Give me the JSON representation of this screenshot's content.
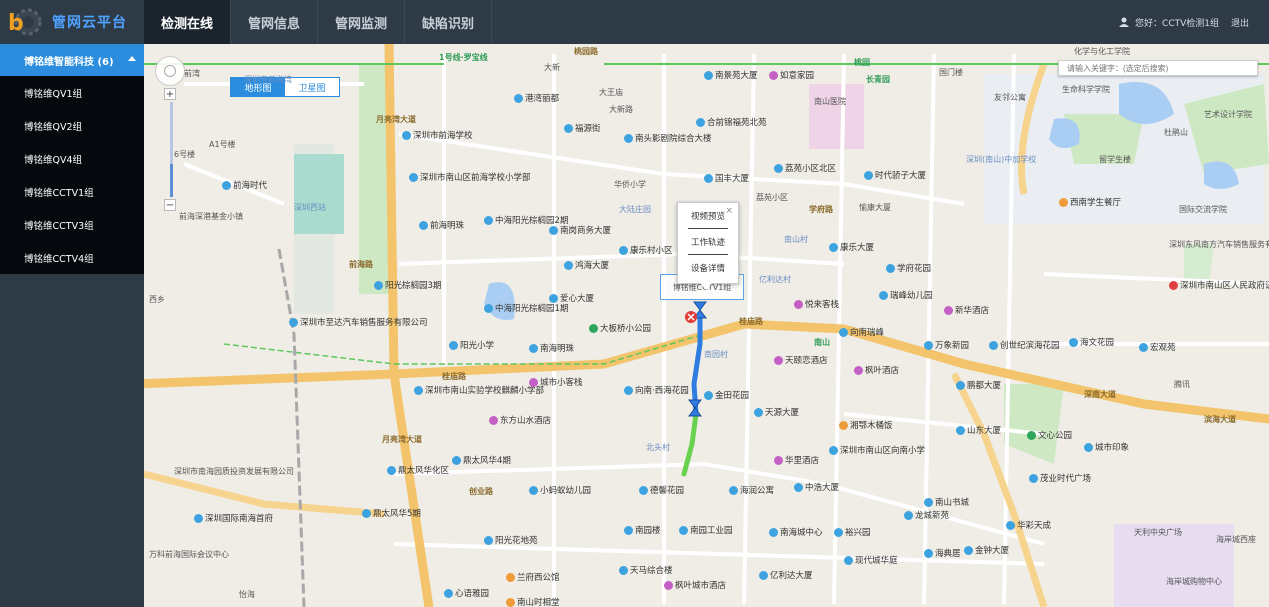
{
  "header": {
    "brand_title": "管网云平台",
    "tabs": [
      {
        "label": "检测在线",
        "active": true
      },
      {
        "label": "管网信息",
        "active": false
      },
      {
        "label": "管网监测",
        "active": false
      },
      {
        "label": "缺陷识别",
        "active": false
      }
    ],
    "user_greeting": "您好：CCTV检测1组",
    "logout_label": "退出"
  },
  "sidebar": {
    "group_label": "博铭维智能科技 (6)",
    "items": [
      {
        "label": "博铭维QV1组"
      },
      {
        "label": "博铭维QV2组"
      },
      {
        "label": "博铭维QV4组"
      },
      {
        "label": "博铭维CCTV1组"
      },
      {
        "label": "博铭维CCTV3组"
      },
      {
        "label": "博铭维CCTV4组"
      }
    ]
  },
  "map": {
    "type_buttons": {
      "map": "地形图",
      "satellite": "卫星图"
    },
    "search_placeholder": "请输入关键字：(选定后搜索)",
    "zoom_level_fraction": 0.35,
    "popup": {
      "items": [
        "视频预览",
        "工作轨迹",
        "设备详情"
      ],
      "close": "×"
    },
    "tooltip_text": "博铭维CCTV1组",
    "labels": {
      "l1": "桃园路",
      "l2": "大新",
      "l3": "港湾丽都",
      "l4": "福源街",
      "l5": "大王庙",
      "l6": "南头影剧院综合大楼",
      "l7": "南景苑大厦",
      "l8": "如意家园",
      "l9": "南山医院",
      "l10": "合前锦福苑北苑",
      "l11": "国丰大厦",
      "l12": "荔苑小区北区",
      "l13": "时代骄子大厦",
      "l14": "深圳市前海学校",
      "l15": "深圳市南山区前海学校小学部",
      "l16": "前海时代",
      "l17": "前海明珠",
      "l18": "中海阳光棕榈园2期",
      "l19": "南岗商务大厦",
      "l20": "康乐村小区",
      "l21": "鸿海大厦",
      "l22": "阳光棕榈园3期",
      "l23": "中海阳光棕榈园1期",
      "l24": "爱心大厦",
      "l25": "大板桥小公园",
      "l26": "深圳市至达汽车销售服务有限公司",
      "l27": "阳光小学",
      "l28": "南海明珠",
      "l29": "深圳市南山实验学校麒麟小学部",
      "l30": "城市小客栈",
      "l31": "东方山水酒店",
      "l32": "向南·西海花园",
      "l33": "金田花园",
      "l34": "天源大厦",
      "l35": "天颐恋酒店",
      "l36": "枫叶酒店",
      "l37": "向南瑞峰",
      "l38": "悦来客栈",
      "l39": "瑞峰幼儿园",
      "l40": "新华酒店",
      "l41": "学府花园",
      "l42": "康乐大厦",
      "l43": "鼎太风华5期",
      "l44": "鼎太风华4期",
      "l45": "鼎太风华化区",
      "l46": "小蚂蚁幼儿园",
      "l47": "德馨花园",
      "l48": "海润公寓",
      "l49": "中浩大厦",
      "l50": "湘鄂木桶饭",
      "l51": "深圳市南山区向南小学",
      "l52": "华里酒店",
      "l53": "山东大厦",
      "l54": "文心公园",
      "l55": "南园楼",
      "l56": "南园工业园",
      "l57": "南海城中心",
      "l58": "裕兴园",
      "l59": "南山书城",
      "l60": "龙城新苑",
      "l61": "华彩天成",
      "l62": "海典居",
      "l63": "金钟大厦",
      "l64": "现代城华庭",
      "l65": "兰府西公馆",
      "l66": "阳光花地苑",
      "l67": "天马综合楼",
      "l68": "枫叶城市酒店",
      "l69": "亿利达大厦",
      "l70": "南山时相堂",
      "l71": "心语雅园",
      "l72": "深圳国际南海首府",
      "l73": "万科前海国际会议中心",
      "l74": "深圳市南海园质投资发展有限公司",
      "l75": "桂庙路",
      "l76": "前海路",
      "l77": "月亮湾大道",
      "l78": "深南大道",
      "l79": "南山",
      "l80": "桃园",
      "l81": "长青园",
      "l82": "国门楼",
      "l83": "友邻公寓",
      "l84": "生命科学学院",
      "l85": "化学与化工学院",
      "l86": "艺术设计学院",
      "l87": "杜鹃山",
      "l88": "留学生楼",
      "l89": "国际交流学院",
      "l90": "西南学生餐厅",
      "l91": "深圳东风南方汽车销售服务有限公司",
      "l92": "深圳市南山区人民政府证民办公室",
      "l93": "创世纪滨海花园",
      "l94": "海文花园",
      "l95": "宏观苑",
      "l96": "万象新园",
      "l97": "鹏都大厦",
      "l98": "茂业时代广场",
      "l99": "城市印象",
      "l100": "天利中央广场",
      "l101": "海岸城购物中心",
      "l102": "海岸城西座",
      "l103": "滨海大道",
      "l104": "腾讯",
      "l105": "深圳市前海湾",
      "l106": "A1号楼",
      "l107": "6号楼",
      "l108": "前海深港基金小镇",
      "l109": "深圳(南山)中加学校",
      "l110": "华侨小学",
      "l111": "愉康大厦",
      "l112": "荔苑小区",
      "l113": "学府路",
      "l114": "创业路",
      "l115": "亿利达村",
      "l116": "南园村",
      "l117": "南山村",
      "l118": "大陆庄园",
      "l119": "北头村",
      "l120": "深圳西站",
      "l121": "西乡",
      "l122": "怡海",
      "l123": "1号线·罗宝线",
      "l124": "大新路",
      "l125": "桂庙路",
      "l126": "月亮湾大道",
      "l127": "前湾"
    }
  }
}
